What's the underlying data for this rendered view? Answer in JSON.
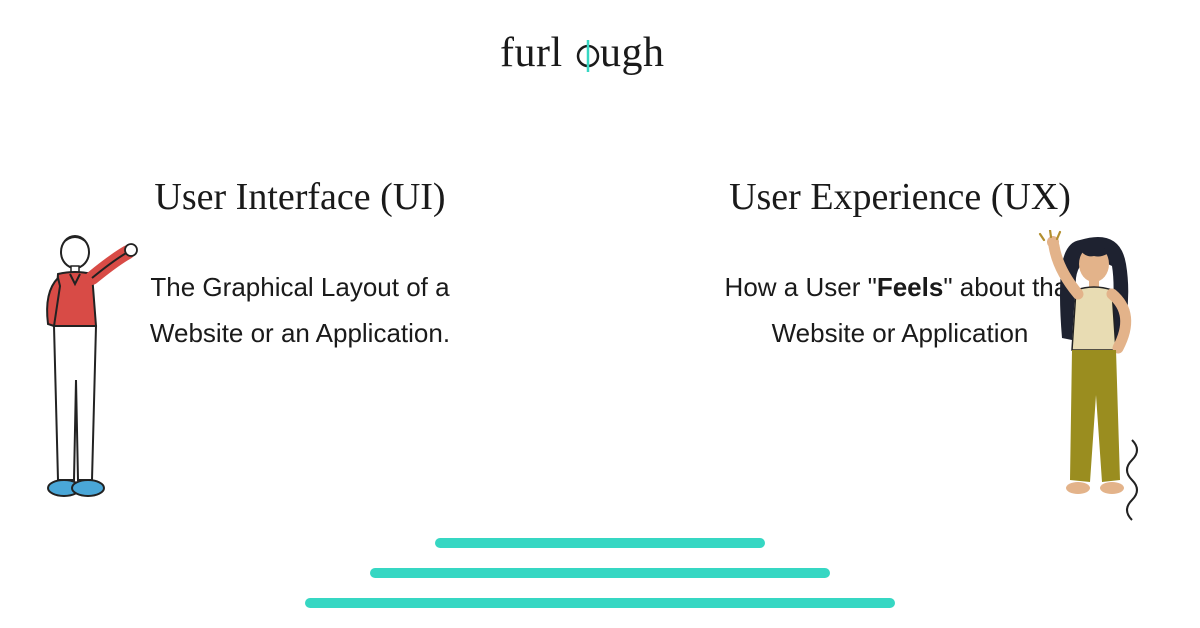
{
  "brand": "furlough",
  "colors": {
    "accent": "#36d7c3",
    "text": "#1a1a1a"
  },
  "columns": {
    "left": {
      "heading": "User Interface (UI)",
      "body_plain": "The Graphical Layout of a Website or an Application."
    },
    "right": {
      "heading": "User Experience (UX)",
      "body_prefix": "How a User \"",
      "body_bold": "Feels",
      "body_suffix": "\" about that Website or Application"
    }
  },
  "illustrations": {
    "left_person": "man-red-shirt-pointing",
    "right_person": "woman-olive-pants-waving"
  },
  "podium_bars": 3
}
